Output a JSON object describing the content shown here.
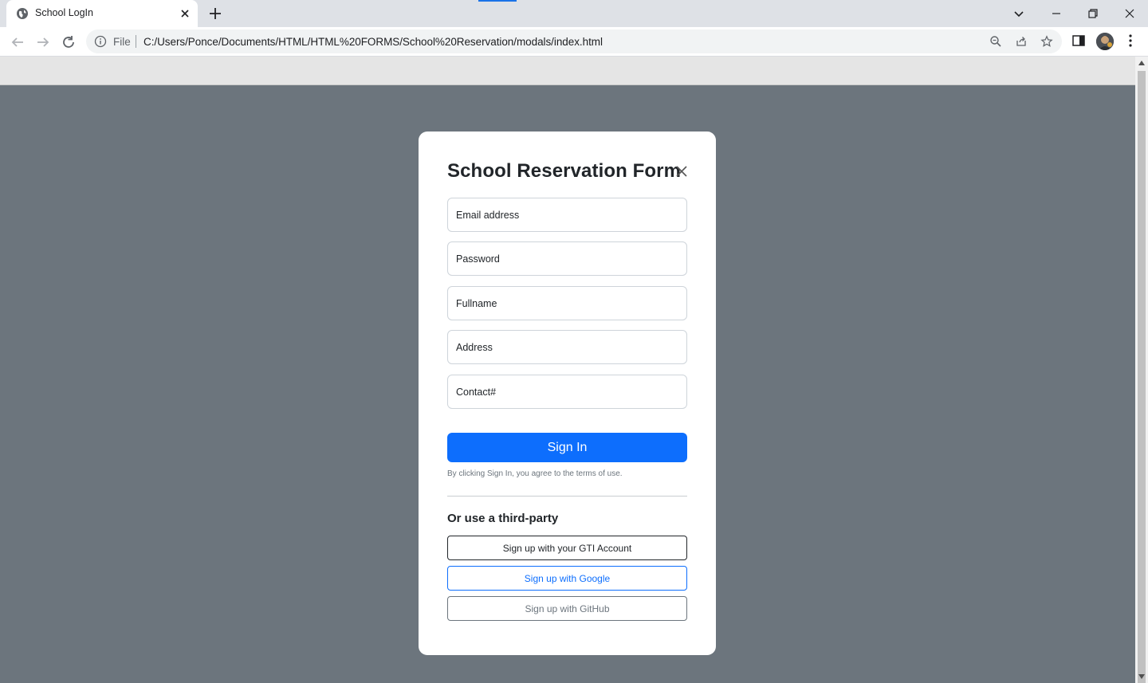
{
  "browser": {
    "tab_title": "School LogIn",
    "file_label": "File",
    "url": "C:/Users/Ponce/Documents/HTML/HTML%20FORMS/School%20Reservation/modals/index.html"
  },
  "modal": {
    "title": "School Reservation Form",
    "fields": {
      "email_placeholder": "Email address",
      "password_placeholder": "Password",
      "fullname_placeholder": "Fullname",
      "address_placeholder": "Address",
      "contact_placeholder": "Contact#"
    },
    "signin_label": "Sign In",
    "terms_text": "By clicking Sign In, you agree to the terms of use.",
    "third_party_title": "Or use a third-party",
    "third_party_buttons": {
      "gti": "Sign up with your GTI Account",
      "google": "Sign up with Google",
      "github": "Sign up with GitHub"
    }
  },
  "colors": {
    "backdrop": "#6c757d",
    "primary": "#0d6efd",
    "dark": "#212529",
    "secondary": "#6c757d"
  }
}
